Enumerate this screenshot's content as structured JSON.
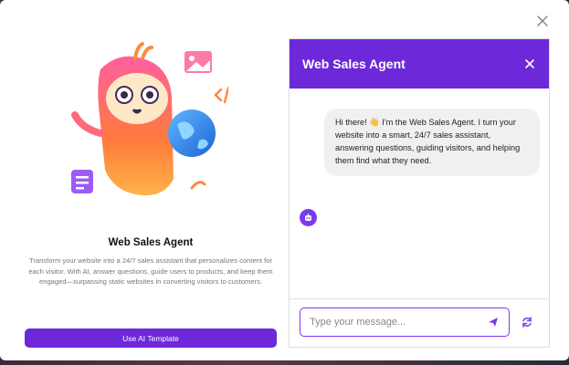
{
  "agent": {
    "title": "Web Sales Agent",
    "description": "Transform your website into a 24/7 sales assistant that personalizes content for each visitor. With AI, answer questions, guide users to products, and keep them engaged—surpassing static websites in converting visitors to customers.",
    "use_button_label": "Use AI Template"
  },
  "chat": {
    "header_title": "Web Sales Agent",
    "messages": [
      {
        "sender": "bot",
        "text": "Hi there! 👋 I'm the Web Sales Agent. I turn your website into a smart, 24/7 sales assistant, answering questions, guiding visitors, and helping them find what they need."
      }
    ],
    "input_placeholder": "Type your message..."
  },
  "colors": {
    "accent": "#6d28d9",
    "bubble": "#f0f0f0"
  },
  "icons": [
    "close-icon",
    "send-icon",
    "refresh-icon",
    "bot-avatar-icon",
    "image-icon",
    "code-icon",
    "globe-icon",
    "document-icon"
  ]
}
